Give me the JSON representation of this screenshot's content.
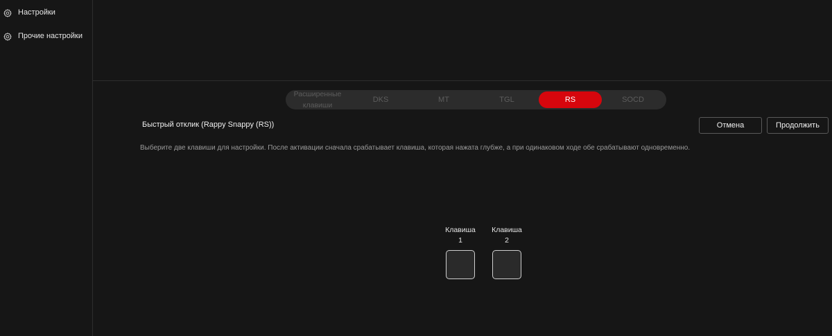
{
  "sidebar": {
    "items": [
      {
        "label": "Настройки",
        "icon": "gear-icon"
      },
      {
        "label": "Прочие настройки",
        "icon": "gear-icon"
      }
    ]
  },
  "tabs": [
    {
      "label": "Расширенные клавиши",
      "active": false
    },
    {
      "label": "DKS",
      "active": false
    },
    {
      "label": "MT",
      "active": false
    },
    {
      "label": "TGL",
      "active": false
    },
    {
      "label": "RS",
      "active": true
    },
    {
      "label": "SOCD",
      "active": false
    }
  ],
  "section": {
    "title": "Быстрый отклик (Rappy Snappy (RS))",
    "description": "Выберите две клавиши для настройки. После активации сначала срабатывает клавиша, которая нажата глубже, а при одинаковом ходе обе срабатывают одновременно."
  },
  "buttons": {
    "cancel_label": "Отмена",
    "continue_label": "Продолжить"
  },
  "keys": [
    {
      "label_line1": "Клавиша",
      "label_line2": "1",
      "value": ""
    },
    {
      "label_line1": "Клавиша",
      "label_line2": "2",
      "value": ""
    }
  ],
  "colors": {
    "accent": "#d6060d",
    "background": "#161616",
    "tab_bar": "#2c2c2c"
  }
}
